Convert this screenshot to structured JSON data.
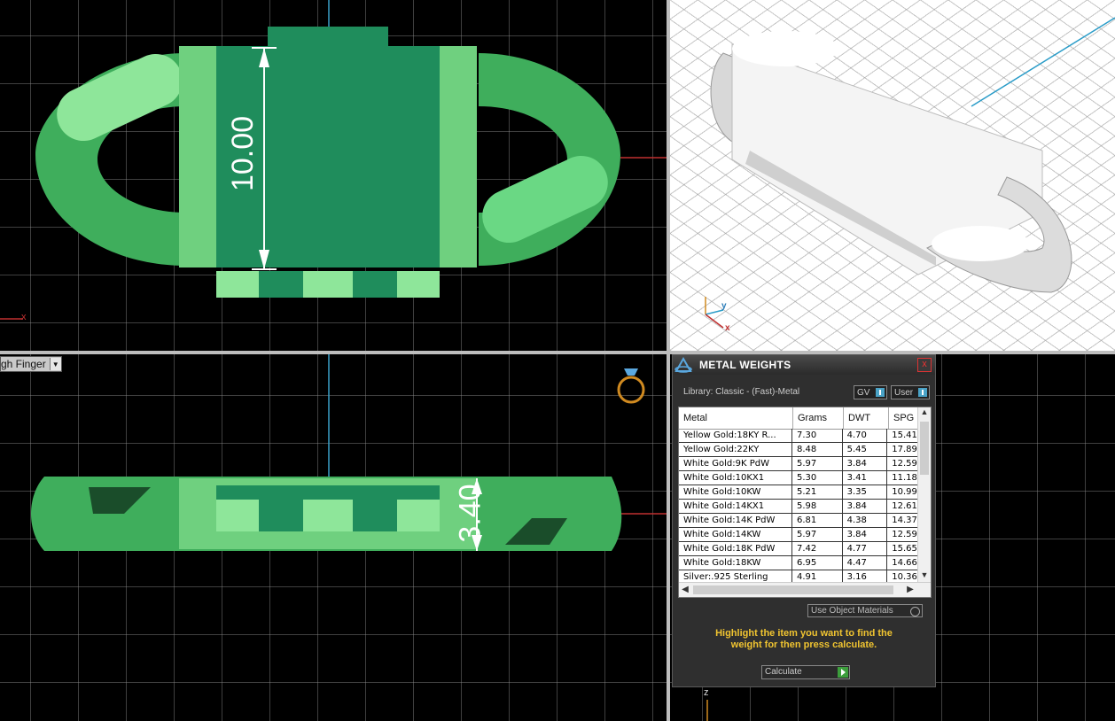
{
  "viewports": {
    "finger_dropdown": "gh Finger",
    "top_dimension": "10.00",
    "front_dimension": "3.40",
    "axis_x": "x",
    "axis_z": "z",
    "persp_axis_y": "y",
    "persp_axis_x": "x"
  },
  "panel": {
    "title": "METAL WEIGHTS",
    "close": "x",
    "library": "Library: Classic - (Fast)-Metal",
    "gv_label": "GV",
    "user_label": "User",
    "columns": [
      "Metal",
      "Grams",
      "DWT",
      "SPG"
    ],
    "rows": [
      {
        "metal": "Yellow Gold:18KY R...",
        "grams": "7.30",
        "dwt": "4.70",
        "spg": "15.41"
      },
      {
        "metal": "Yellow Gold:22KY",
        "grams": "8.48",
        "dwt": "5.45",
        "spg": "17.89"
      },
      {
        "metal": "White Gold:9K PdW",
        "grams": "5.97",
        "dwt": "3.84",
        "spg": "12.59"
      },
      {
        "metal": "White Gold:10KX1",
        "grams": "5.30",
        "dwt": "3.41",
        "spg": "11.18"
      },
      {
        "metal": "White Gold:10KW",
        "grams": "5.21",
        "dwt": "3.35",
        "spg": "10.99"
      },
      {
        "metal": "White Gold:14KX1",
        "grams": "5.98",
        "dwt": "3.84",
        "spg": "12.61"
      },
      {
        "metal": "White Gold:14K PdW",
        "grams": "6.81",
        "dwt": "4.38",
        "spg": "14.37"
      },
      {
        "metal": "White Gold:14KW",
        "grams": "5.97",
        "dwt": "3.84",
        "spg": "12.59"
      },
      {
        "metal": "White Gold:18K PdW",
        "grams": "7.42",
        "dwt": "4.77",
        "spg": "15.65"
      },
      {
        "metal": "White Gold:18KW",
        "grams": "6.95",
        "dwt": "4.47",
        "spg": "14.66"
      },
      {
        "metal": "Silver:.925 Sterling",
        "grams": "4.91",
        "dwt": "3.16",
        "spg": "10.36"
      }
    ],
    "use_object_materials": "Use Object Materials",
    "hint": "Highlight the item you want to find the weight for then press calculate.",
    "calculate": "Calculate"
  },
  "colors": {
    "model_light": "#7ee08a",
    "model_dark": "#1e8a5a",
    "accent_title": "#f0c430"
  }
}
